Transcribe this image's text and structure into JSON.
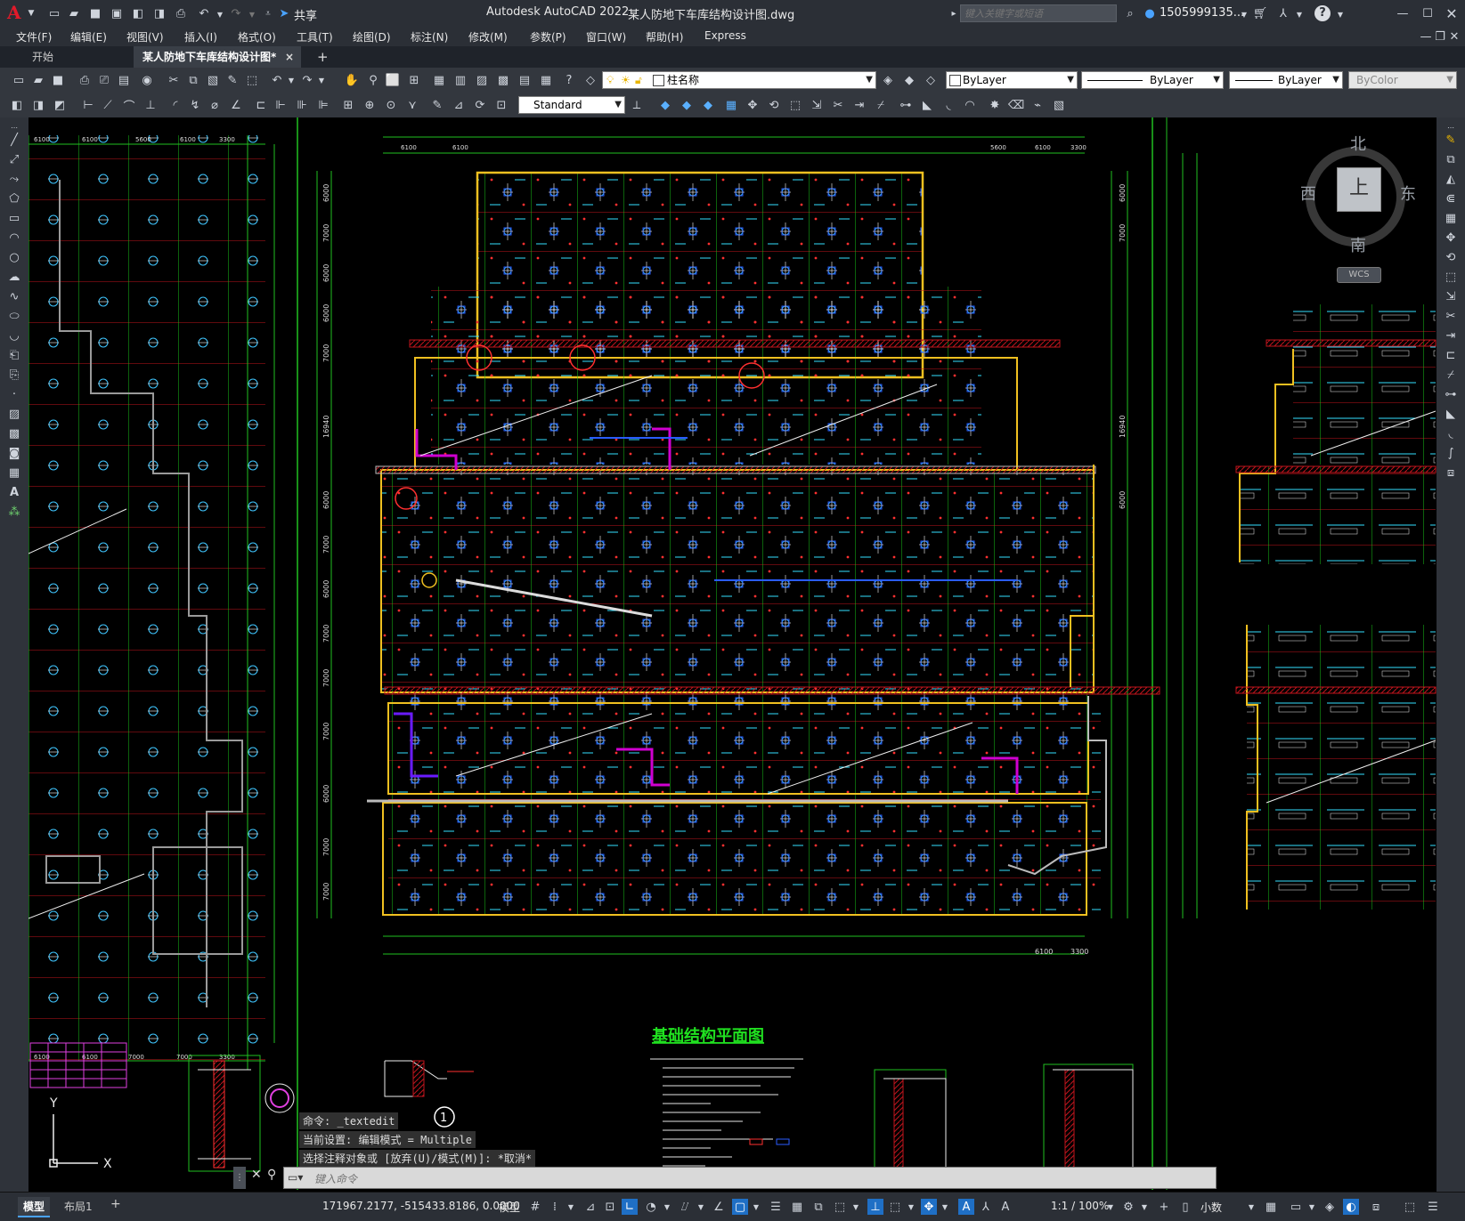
{
  "app": {
    "logo": "A",
    "title": "Autodesk AutoCAD 2022",
    "filename": "某人防地下车库结构设计图.dwg",
    "share": "共享",
    "search_placeholder": "键入关键字或短语",
    "user": "1505999135...",
    "help_icon": "?"
  },
  "menu": [
    "文件(F)",
    "编辑(E)",
    "视图(V)",
    "插入(I)",
    "格式(O)",
    "工具(T)",
    "绘图(D)",
    "标注(N)",
    "修改(M)",
    "参数(P)",
    "窗口(W)",
    "帮助(H)",
    "Express"
  ],
  "tabs": {
    "start": "开始",
    "drawing": "某人防地下车库结构设计图*",
    "close": "×",
    "add": "+"
  },
  "toolbar": {
    "layer": "柱名称",
    "color": "ByLayer",
    "linetype": "ByLayer",
    "lineweight": "ByLayer",
    "plotstyle": "ByColor",
    "textstyle": "Standard"
  },
  "viewcube": {
    "north": "北",
    "south": "南",
    "east": "东",
    "west": "西",
    "top": "上",
    "wcs": "WCS"
  },
  "drawing": {
    "title": "基础结构平面图",
    "dims_top": [
      "6100",
      "6100",
      "5600",
      "6100",
      "3300"
    ],
    "dims_bottom": [
      "6100",
      "6100",
      "7000",
      "7000",
      "3300"
    ],
    "dims_side": [
      "6000",
      "7000",
      "6000",
      "6000",
      "7000",
      "16940",
      "6000",
      "7000",
      "6000",
      "7000",
      "7000",
      "7000",
      "6000",
      "7000",
      "7000"
    ],
    "detail_marker": "1",
    "axis_y": "Y",
    "axis_x": "X"
  },
  "command": {
    "history": [
      "命令: _textedit",
      "当前设置: 编辑模式 = Multiple",
      "选择注释对象或 [放弃(U)/模式(M)]: *取消*"
    ],
    "placeholder": "键入命令"
  },
  "layout_tabs": [
    "模型",
    "布局1",
    "+"
  ],
  "status": {
    "coords": "171967.2177, -515433.8186, 0.0000",
    "mode": "模型",
    "scale": "1:1 / 100%",
    "units": "小数"
  }
}
